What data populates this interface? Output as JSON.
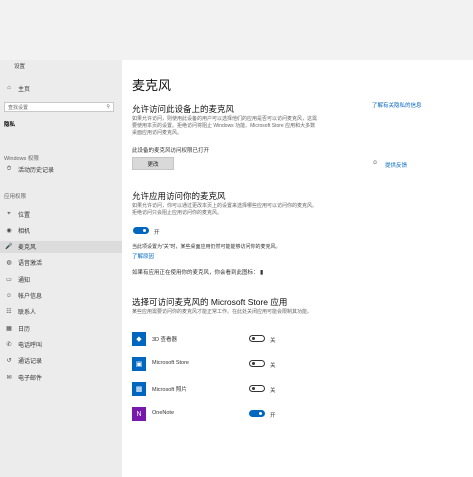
{
  "window": {
    "title": "设置"
  },
  "sidebar": {
    "home": "主页",
    "search_placeholder": "查找设置",
    "current_section": "隐私",
    "windows_permissions_header": "Windows 权限",
    "windows_items": [
      {
        "icon": "activity-history-icon",
        "glyph": "⏱",
        "label": "活动历史记录"
      }
    ],
    "app_permissions_header": "应用权限",
    "app_items": [
      {
        "icon": "location-icon",
        "glyph": "⌖",
        "label": "位置"
      },
      {
        "icon": "camera-icon",
        "glyph": "◉",
        "label": "相机"
      },
      {
        "icon": "microphone-icon",
        "glyph": "🎤",
        "label": "麦克风"
      },
      {
        "icon": "voice-activation-icon",
        "glyph": "◍",
        "label": "语音激活"
      },
      {
        "icon": "notifications-icon",
        "glyph": "▭",
        "label": "通知"
      },
      {
        "icon": "account-info-icon",
        "glyph": "☺",
        "label": "帐户信息"
      },
      {
        "icon": "contacts-icon",
        "glyph": "☷",
        "label": "联系人"
      },
      {
        "icon": "calendar-icon",
        "glyph": "▦",
        "label": "日历"
      },
      {
        "icon": "phone-calls-icon",
        "glyph": "✆",
        "label": "电话呼叫"
      },
      {
        "icon": "call-history-icon",
        "glyph": "↺",
        "label": "通话记录"
      },
      {
        "icon": "email-icon",
        "glyph": "✉",
        "label": "电子邮件"
      }
    ]
  },
  "main": {
    "page_title": "麦克风",
    "device_section": {
      "heading": "允许访问此设备上的麦克风",
      "description": "如果允许访问，则使用此设备的用户可以选择他们的应用是否可以访问麦克风，这需要使用本页的设置。拒绝访问将阻止 Windows 功能、Microsoft Store 应用和大多数桌面应用访问麦克风。",
      "status": "此设备的麦克风访问权限已打开",
      "change_button": "更改"
    },
    "apps_section": {
      "heading": "允许应用访问你的麦克风",
      "description": "如果允许访问，你可以通过更改本页上的设置来选择哪些应用可以访问你的麦克风。拒绝访问只会阻止应用访问你的麦克风。",
      "toggle_state": "开",
      "toggle_on": true,
      "note": "当此项设置为\"关\"时，某些桌面应用仍然可能能够访问你的麦克风。",
      "learn_more": "了解原因",
      "usage_note": "如果有应用正在使用你的麦克风，你会看到此图标："
    },
    "store_section": {
      "heading": "选择可访问麦克风的 Microsoft Store 应用",
      "description": "某些应用需要访问你的麦克风才能正常工作。在此处关闭应用可能会限制其功能。",
      "apps": [
        {
          "name": "3D 查看器",
          "state": "关",
          "on": false,
          "color": "#0067c0",
          "icon": "3d-viewer-icon",
          "glyph": "◆"
        },
        {
          "name": "Microsoft Store",
          "state": "关",
          "on": false,
          "color": "#0067c0",
          "icon": "store-icon",
          "glyph": "▣"
        },
        {
          "name": "Microsoft 照片",
          "state": "关",
          "on": false,
          "color": "#0067c0",
          "icon": "photos-icon",
          "glyph": "▩"
        },
        {
          "name": "OneNote",
          "state": "开",
          "on": true,
          "color": "#7719aa",
          "icon": "onenote-icon",
          "glyph": "N"
        }
      ]
    }
  },
  "right_panel": {
    "link1": "了解有关隐私的信息",
    "link2": "",
    "link3": "",
    "link4": "",
    "feedback": "提供反馈"
  }
}
